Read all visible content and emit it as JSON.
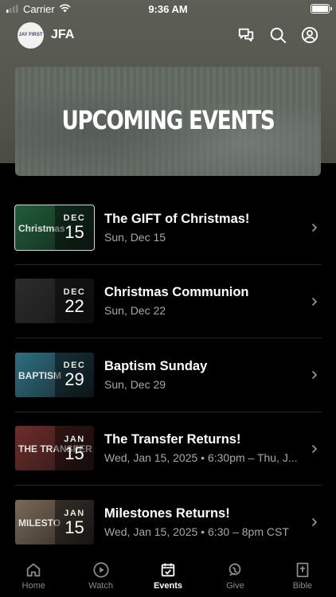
{
  "status_bar": {
    "carrier": "Carrier",
    "time": "9:36 AM"
  },
  "header": {
    "logo_text": "JAY FIRST",
    "app_name": "JFA"
  },
  "hero": {
    "title": "UPCOMING EVENTS"
  },
  "events": [
    {
      "title": "The GIFT of Christmas!",
      "subtitle": "Sun, Dec 15",
      "month": "DEC",
      "day": "15",
      "thumb_text": "Christmas",
      "thumb_color": "#1f5e3a"
    },
    {
      "title": "Christmas Communion",
      "subtitle": "Sun, Dec 22",
      "month": "DEC",
      "day": "22",
      "thumb_text": "",
      "thumb_color": "#2c2c2c"
    },
    {
      "title": "Baptism Sunday",
      "subtitle": "Sun, Dec 29",
      "month": "DEC",
      "day": "29",
      "thumb_text": "BAPTISM",
      "thumb_color": "#2f6f80"
    },
    {
      "title": "The Transfer Returns!",
      "subtitle": "Wed, Jan 15, 2025 • 6:30pm – Thu, J...",
      "month": "JAN",
      "day": "15",
      "thumb_text": "THE TRANSFER",
      "thumb_color": "#6e2d2a"
    },
    {
      "title": "Milestones Returns!",
      "subtitle": "Wed, Jan 15, 2025 • 6:30 – 8pm CST",
      "month": "JAN",
      "day": "15",
      "thumb_text": "MILESTO",
      "thumb_color": "#7a6a58"
    }
  ],
  "tabs": [
    {
      "label": "Home",
      "icon": "home-icon",
      "active": false
    },
    {
      "label": "Watch",
      "icon": "play-circle-icon",
      "active": false
    },
    {
      "label": "Events",
      "icon": "calendar-icon",
      "active": true
    },
    {
      "label": "Give",
      "icon": "give-icon",
      "active": false
    },
    {
      "label": "Bible",
      "icon": "bible-icon",
      "active": false
    }
  ],
  "colors": {
    "background": "#000000",
    "top_band": "#57584e",
    "text_secondary": "#a7a7a7"
  }
}
